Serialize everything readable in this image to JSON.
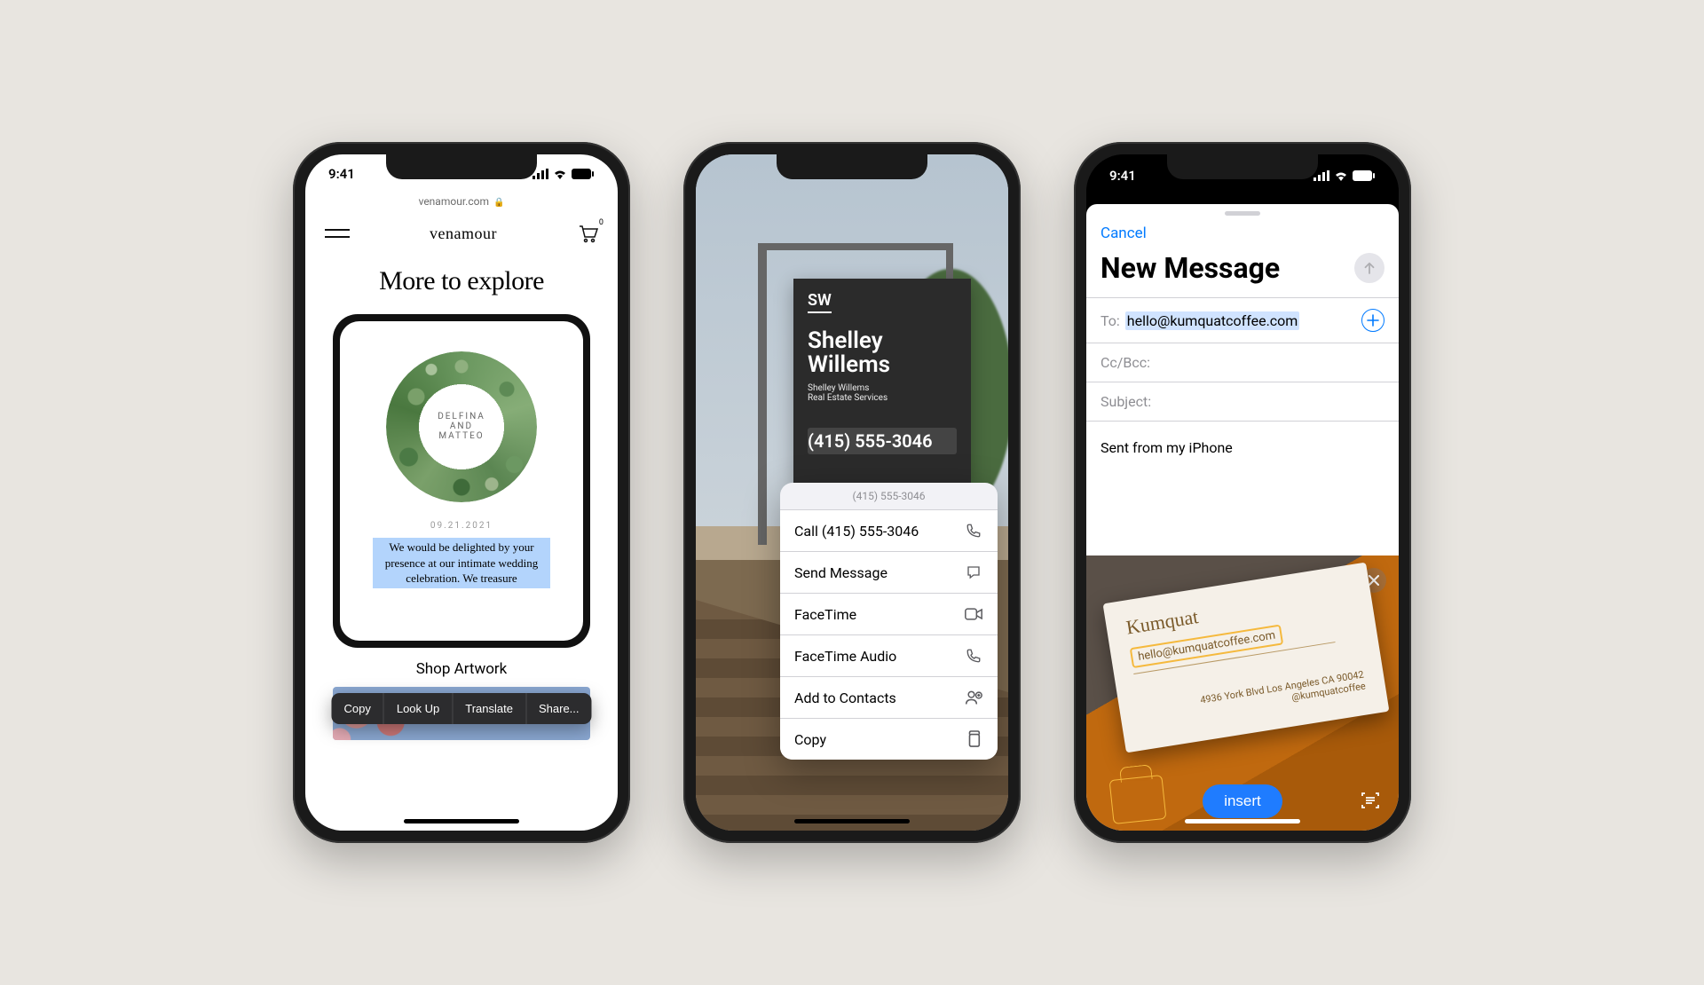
{
  "status": {
    "time": "9:41"
  },
  "phone1": {
    "url": "venamour.com",
    "brand": "venamour",
    "cart_badge": "0",
    "hero": "More to explore",
    "invite_names": "DELFINA\nAND\nMATTEO",
    "invite_date": "09.21.2021",
    "selection_menu": [
      "Copy",
      "Look Up",
      "Translate",
      "Share..."
    ],
    "selected_text": "We would be delighted by your presence at our intimate wedding celebration. We treasure",
    "shop": "Shop Artwork"
  },
  "phone2": {
    "sign_logo": "SW",
    "sign_name1": "Shelley",
    "sign_name2": "Willems",
    "sign_sub1": "Shelley Willems",
    "sign_sub2": "Real Estate Services",
    "sign_phone": "(415) 555-3046",
    "menu_header": "(415) 555-3046",
    "items": [
      {
        "label": "Call (415) 555-3046",
        "icon": "phone"
      },
      {
        "label": "Send Message",
        "icon": "message"
      },
      {
        "label": "FaceTime",
        "icon": "video"
      },
      {
        "label": "FaceTime Audio",
        "icon": "phone"
      },
      {
        "label": "Add to Contacts",
        "icon": "contact"
      },
      {
        "label": "Copy",
        "icon": "copy"
      }
    ]
  },
  "phone3": {
    "cancel": "Cancel",
    "title": "New Message",
    "to_label": "To:",
    "to_value": "hello@kumquatcoffee.com",
    "ccbcc": "Cc/Bcc:",
    "subject": "Subject:",
    "signature": "Sent from my iPhone",
    "card_name": "Kumquat",
    "card_email": "hello@kumquatcoffee.com",
    "card_addr": "4936 York Blvd Los Angeles CA 90042",
    "card_social": "@kumquatcoffee",
    "insert": "insert"
  }
}
